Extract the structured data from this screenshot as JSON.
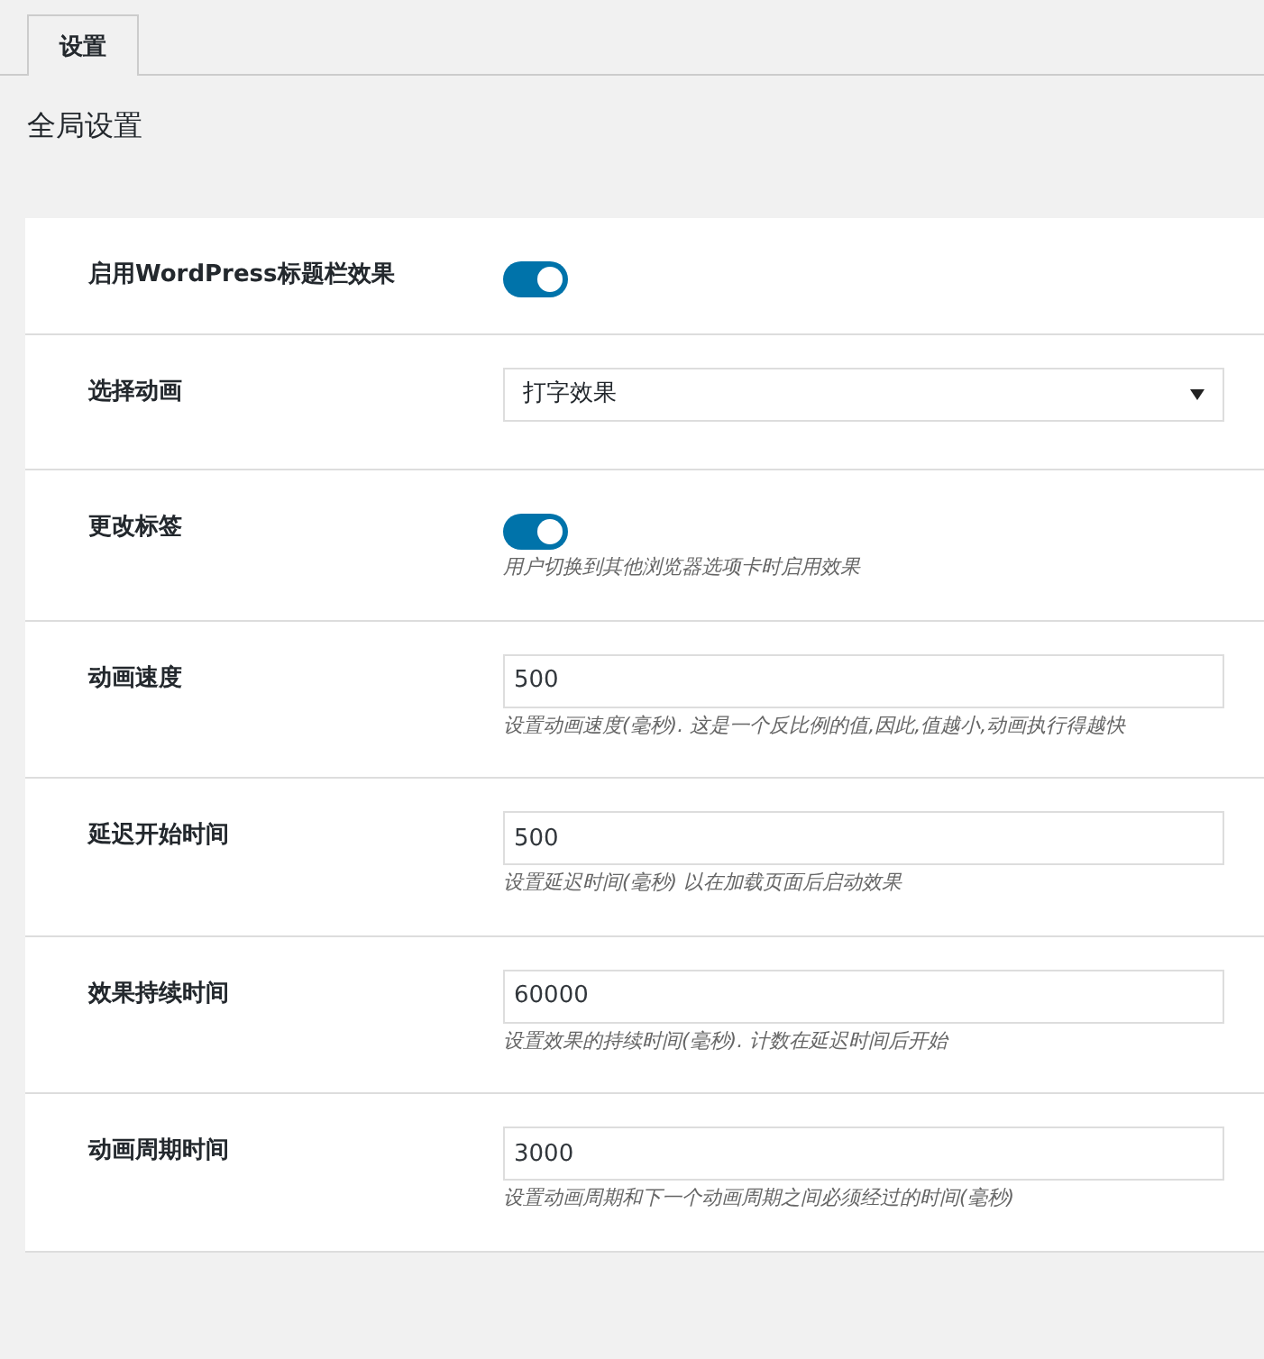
{
  "tabs": [
    {
      "label": "设置",
      "selected": true
    }
  ],
  "heading": "全局设置",
  "settings": [
    {
      "kind": "toggle",
      "label": "启用WordPress标题栏效果",
      "on": true
    },
    {
      "kind": "select",
      "label": "选择动画",
      "value": "打字效果"
    },
    {
      "kind": "toggle",
      "label": "更改标签",
      "on": true,
      "description": "用户切换到其他浏览器选项卡时启用效果"
    },
    {
      "kind": "number",
      "label": "动画速度",
      "value": "500",
      "description": "设置动画速度(毫秒). 这是一个反比例的值,因此,值越小,动画执行得越快"
    },
    {
      "kind": "number",
      "label": "延迟开始时间",
      "value": "500",
      "description": "设置延迟时间(毫秒) 以在加载页面后启动效果"
    },
    {
      "kind": "number",
      "label": "效果持续时间",
      "value": "60000",
      "description": "设置效果的持续时间(毫秒). 计数在延迟时间后开始"
    },
    {
      "kind": "number",
      "label": "动画周期时间",
      "value": "3000",
      "description": "设置动画周期和下一个动画周期之间必须经过的时间(毫秒)"
    }
  ]
}
